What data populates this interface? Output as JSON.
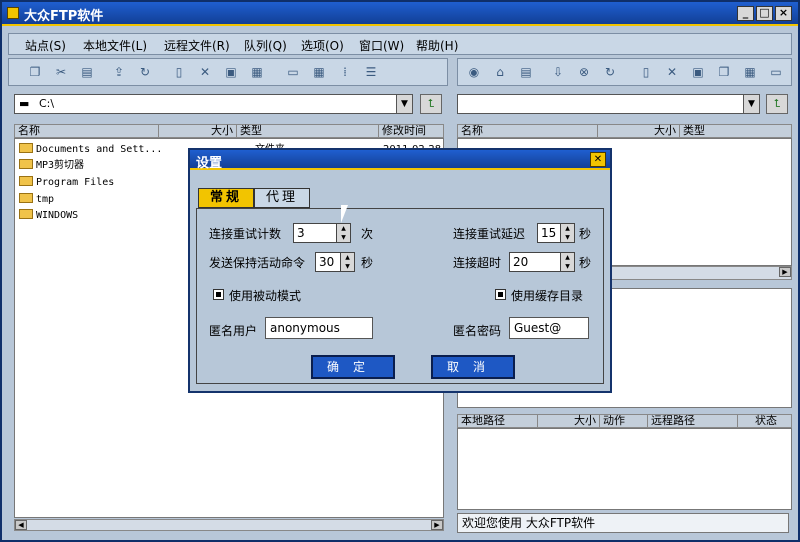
{
  "window": {
    "title": "大众FTP软件"
  },
  "menu": [
    "站点(S)",
    "本地文件(L)",
    "远程文件(R)",
    "队列(Q)",
    "选项(O)",
    "窗口(W)",
    "帮助(H)"
  ],
  "local": {
    "path": "C:\\",
    "columns": [
      "名称",
      "大小",
      "类型",
      "修改时间"
    ],
    "files": [
      {
        "name": "Documents and Sett...",
        "type": "文件夹",
        "modified": "2011-02-28"
      },
      {
        "name": "MP3剪切器"
      },
      {
        "name": "Program Files"
      },
      {
        "name": "tmp"
      },
      {
        "name": "WINDOWS"
      }
    ]
  },
  "remote": {
    "path": "",
    "columns": [
      "名称",
      "大小",
      "类型"
    ]
  },
  "queue": {
    "columns": [
      "本地路径",
      "大小",
      "动作",
      "远程路径",
      "状态"
    ]
  },
  "status": "欢迎您使用 大众FTP软件",
  "dialog": {
    "title": "设置",
    "tabs": [
      "常规",
      "代理"
    ],
    "retry_count_label": "连接重试计数",
    "retry_count_value": "3",
    "retry_count_unit": "次",
    "retry_delay_label": "连接重试延迟",
    "retry_delay_value": "15",
    "retry_delay_unit": "秒",
    "keepalive_label": "发送保持活动命令",
    "keepalive_value": "30",
    "keepalive_unit": "秒",
    "timeout_label": "连接超时",
    "timeout_value": "20",
    "timeout_unit": "秒",
    "passive_label": "使用被动模式",
    "cache_label": "使用缓存目录",
    "anon_user_label": "匿名用户",
    "anon_user_value": "anonymous",
    "anon_pass_label": "匿名密码",
    "anon_pass_value": "Guest@",
    "ok_label": "确定",
    "cancel_label": "取消"
  }
}
